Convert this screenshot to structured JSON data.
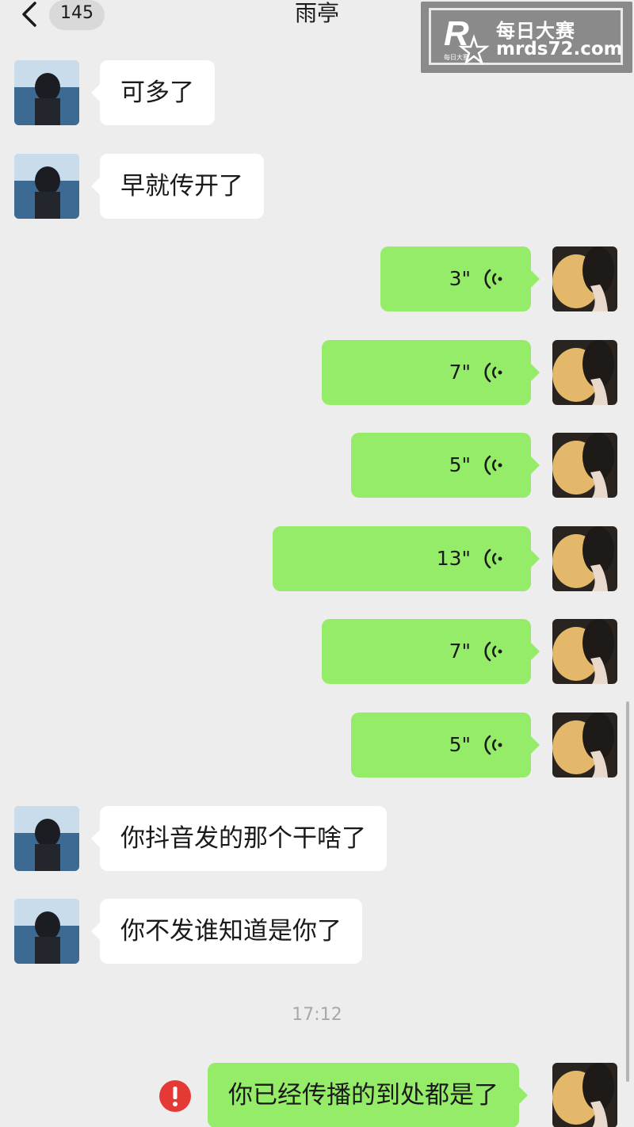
{
  "header": {
    "unread_count": "145",
    "title": "雨亭"
  },
  "watermark": {
    "logo_letter": "R",
    "logo_small_text": "每日大赛",
    "name": "每日大赛",
    "url": "mrds72.com"
  },
  "colors": {
    "background": "#ededed",
    "received_bubble": "#ffffff",
    "sent_bubble": "#95ec69",
    "error_badge": "#e53935"
  },
  "messages": [
    {
      "side": "left",
      "type": "text",
      "text": "可多了"
    },
    {
      "side": "left",
      "type": "text",
      "text": "早就传开了"
    },
    {
      "side": "right",
      "type": "voice",
      "duration": "3\""
    },
    {
      "side": "right",
      "type": "voice",
      "duration": "7\""
    },
    {
      "side": "right",
      "type": "voice",
      "duration": "5\""
    },
    {
      "side": "right",
      "type": "voice",
      "duration": "13\""
    },
    {
      "side": "right",
      "type": "voice",
      "duration": "7\""
    },
    {
      "side": "right",
      "type": "voice",
      "duration": "5\""
    },
    {
      "side": "left",
      "type": "text",
      "text": "你抖音发的那个干啥了"
    },
    {
      "side": "left",
      "type": "text",
      "text": "你不发谁知道是你了"
    },
    {
      "side": "right",
      "type": "text",
      "text": "你已经传播的到处都是了",
      "send_failed": true
    }
  ],
  "timestamp": "17:12"
}
